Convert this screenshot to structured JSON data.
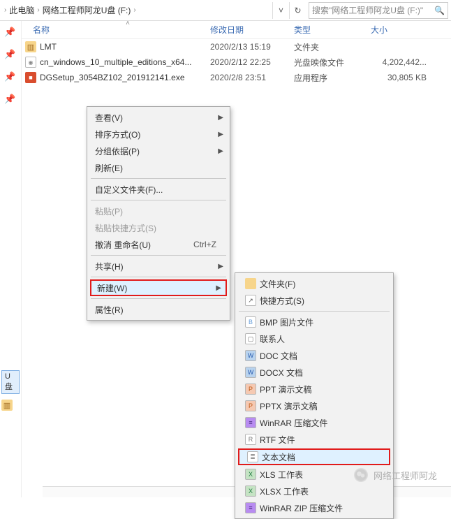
{
  "topbar": {
    "loc1": "此电脑",
    "loc2": "网络工程师阿龙U盘 (F:)",
    "search_placeholder": "搜索\"网络工程师阿龙U盘 (F:)\""
  },
  "pins": {
    "tag": "U盘"
  },
  "columns": {
    "name": "名称",
    "date": "修改日期",
    "type": "类型",
    "size": "大小"
  },
  "rows": [
    {
      "icon": "folder",
      "name": "LMT",
      "date": "2020/2/13 15:19",
      "type": "文件夹",
      "size": ""
    },
    {
      "icon": "disc",
      "name": "cn_windows_10_multiple_editions_x64...",
      "date": "2020/2/12 22:25",
      "type": "光盘映像文件",
      "size": "4,202,442..."
    },
    {
      "icon": "exe",
      "name": "DGSetup_3054BZ102_201912141.exe",
      "date": "2020/2/8 23:51",
      "type": "应用程序",
      "size": "30,805 KB"
    }
  ],
  "ctx": {
    "view": "查看(V)",
    "sort": "排序方式(O)",
    "group": "分组依据(P)",
    "refresh": "刷新(E)",
    "custom": "自定义文件夹(F)...",
    "paste": "粘贴(P)",
    "pasteShortcut": "粘贴快捷方式(S)",
    "undo": "撤消 重命名(U)",
    "undo_sc": "Ctrl+Z",
    "share": "共享(H)",
    "new": "新建(W)",
    "properties": "属性(R)"
  },
  "newmenu": [
    {
      "icon": "folder",
      "color": "#f7d58b",
      "txt": "",
      "label": "文件夹(F)"
    },
    {
      "icon": "link",
      "color": "#fff",
      "txt": "↗",
      "label": "快捷方式(S)"
    },
    {
      "sep": true
    },
    {
      "icon": "doc",
      "color": "#fff",
      "txt": "B",
      "tc": "#6aa0da",
      "label": "BMP 图片文件"
    },
    {
      "icon": "doc",
      "color": "#fff",
      "txt": "▢",
      "tc": "#666",
      "label": "联系人"
    },
    {
      "icon": "doc",
      "color": "#b9d3ee",
      "txt": "W",
      "tc": "#2a5db0",
      "label": "DOC 文档"
    },
    {
      "icon": "doc",
      "color": "#b9d3ee",
      "txt": "W",
      "tc": "#2a5db0",
      "label": "DOCX 文档"
    },
    {
      "icon": "doc",
      "color": "#f5c9b2",
      "txt": "P",
      "tc": "#c15915",
      "label": "PPT 演示文稿"
    },
    {
      "icon": "doc",
      "color": "#f5c9b2",
      "txt": "P",
      "tc": "#c15915",
      "label": "PPTX 演示文稿"
    },
    {
      "icon": "doc",
      "color": "#b88cf1",
      "txt": "≡",
      "tc": "#472a80",
      "label": "WinRAR 压缩文件"
    },
    {
      "icon": "doc",
      "color": "#fff",
      "txt": "R",
      "tc": "#777",
      "label": "RTF 文件"
    },
    {
      "icon": "doc",
      "color": "#fff",
      "txt": "≣",
      "tc": "#888",
      "label": "文本文档",
      "highlight": true
    },
    {
      "icon": "doc",
      "color": "#c5e3c4",
      "txt": "X",
      "tc": "#1f7a3e",
      "label": "XLS 工作表"
    },
    {
      "icon": "doc",
      "color": "#c5e3c4",
      "txt": "X",
      "tc": "#1f7a3e",
      "label": "XLSX 工作表"
    },
    {
      "icon": "doc",
      "color": "#b88cf1",
      "txt": "≡",
      "tc": "#472a80",
      "label": "WinRAR ZIP 压缩文件"
    }
  ],
  "watermark": "网络工程师阿龙"
}
